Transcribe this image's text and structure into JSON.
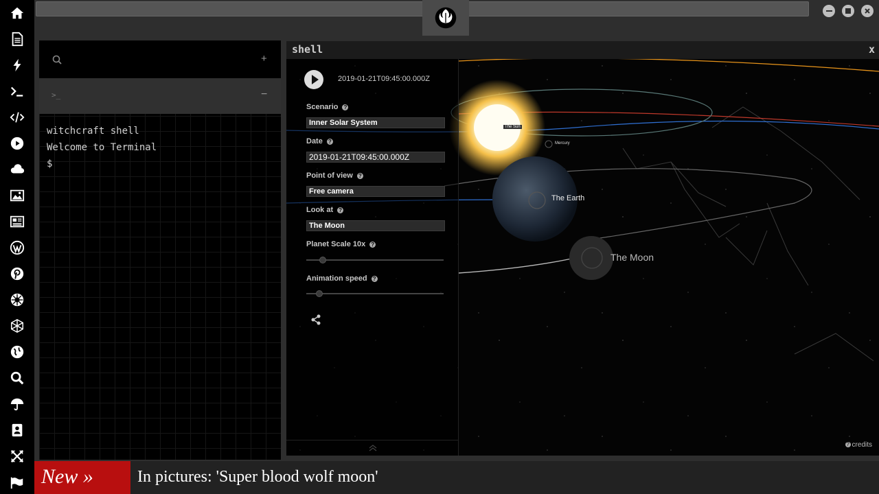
{
  "shell": {
    "title": "shell",
    "close": "x"
  },
  "terminal": {
    "lines": "witchcraft shell\nWelcome to Terminal\n$",
    "search_add": "+",
    "active_minus": "−",
    "prompt_icon": ">_"
  },
  "sim": {
    "timestamp": "2019-01-21T09:45:00.000Z",
    "scenario_label": "Scenario",
    "scenario_value": "Inner Solar System",
    "date_label": "Date",
    "date_value": "2019-01-21T09:45:00.000Z",
    "pov_label": "Point of view",
    "pov_value": "Free camera",
    "lookat_label": "Look at",
    "lookat_value": "The Moon",
    "scale_label": "Planet Scale 10x",
    "speed_label": "Animation speed",
    "help_glyph": "?",
    "labels": {
      "sun": "The Sun",
      "mercury": "Mercury",
      "earth": "The Earth",
      "moon": "The Moon"
    },
    "credits": "credits"
  },
  "news": {
    "tag": "New »",
    "headline": "In pictures: 'Super blood wolf moon'"
  },
  "colors": {
    "news_red": "#b80f0f",
    "orbit_orange": "#e8941a",
    "orbit_red": "#c0392b",
    "orbit_blue": "#2f6fd1"
  },
  "icons": [
    "home-icon",
    "document-icon",
    "bolt-icon",
    "terminal-icon",
    "code-icon",
    "play-icon",
    "cloud-icon",
    "image-icon",
    "newspaper-icon",
    "wordpress-icon",
    "pinterest-icon",
    "empire-icon",
    "network-icon",
    "globe-icon",
    "search-icon",
    "umbrella-icon",
    "contact-icon",
    "expand-icon",
    "flag-icon"
  ]
}
